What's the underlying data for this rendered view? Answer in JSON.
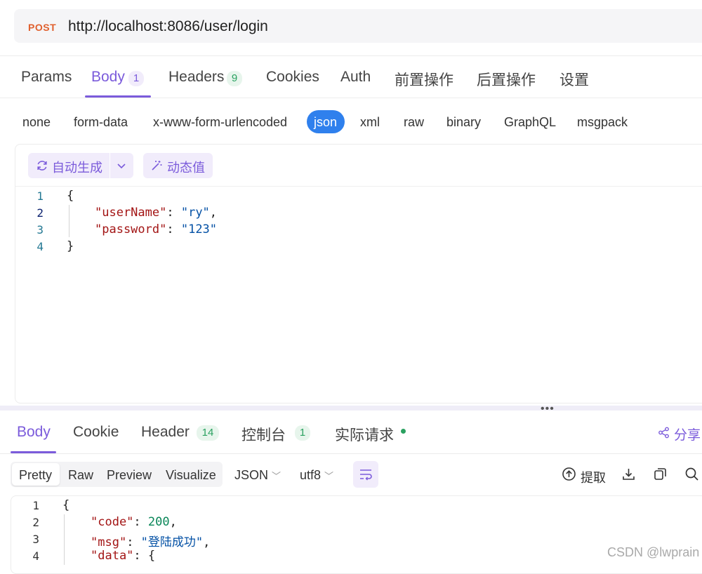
{
  "request": {
    "method": "POST",
    "url": "http://localhost:8086/user/login",
    "tabs": [
      {
        "label": "Params"
      },
      {
        "label": "Body",
        "count": "1"
      },
      {
        "label": "Headers",
        "count": "9"
      },
      {
        "label": "Cookies"
      },
      {
        "label": "Auth"
      },
      {
        "label": "前置操作"
      },
      {
        "label": "后置操作"
      },
      {
        "label": "设置"
      }
    ],
    "body_types": [
      "none",
      "form-data",
      "x-www-form-urlencoded",
      "json",
      "xml",
      "raw",
      "binary",
      "GraphQL",
      "msgpack"
    ],
    "selected_body_type": "json",
    "editor": {
      "autogen_label": "自动生成",
      "dynamic_label": "动态值",
      "line_numbers": [
        "1",
        "2",
        "3",
        "4"
      ],
      "lines": [
        {
          "text": "{"
        },
        {
          "key": "\"userName\"",
          "sep": ": ",
          "value": "\"ry\"",
          "end": ","
        },
        {
          "key": "\"password\"",
          "sep": ": ",
          "value": "\"123\"",
          "end": ""
        },
        {
          "text": "}"
        }
      ]
    }
  },
  "response": {
    "tabs": [
      {
        "label": "Body"
      },
      {
        "label": "Cookie"
      },
      {
        "label": "Header",
        "count": "14"
      },
      {
        "label": "控制台",
        "count": "1"
      },
      {
        "label": "实际请求"
      }
    ],
    "share_label": "分享",
    "view_modes": [
      "Pretty",
      "Raw",
      "Preview",
      "Visualize"
    ],
    "format_select": "JSON",
    "encoding_select": "utf8",
    "extract_label": "提取",
    "line_numbers": [
      "1",
      "2",
      "3",
      "4"
    ],
    "lines": [
      {
        "text": "{"
      },
      {
        "key": "\"code\"",
        "sep": ": ",
        "value": "200",
        "end": ","
      },
      {
        "key": "\"msg\"",
        "sep": ": ",
        "value": "\"登陆成功\"",
        "end": ","
      },
      {
        "key": "\"data\"",
        "sep": ": ",
        "value": "",
        "end": "{"
      }
    ]
  },
  "watermark": "CSDN @lwprain",
  "colors": {
    "accent": "#7b5bdb",
    "method": "#e0602e",
    "json_pill": "#2f80ed",
    "success": "#2aa160"
  },
  "icons": [
    "refresh-icon",
    "chevron-down-icon",
    "magic-wand-icon",
    "share-icon",
    "wrap-lines-icon",
    "upload-circle-icon",
    "download-icon",
    "copy-icon",
    "search-icon"
  ]
}
